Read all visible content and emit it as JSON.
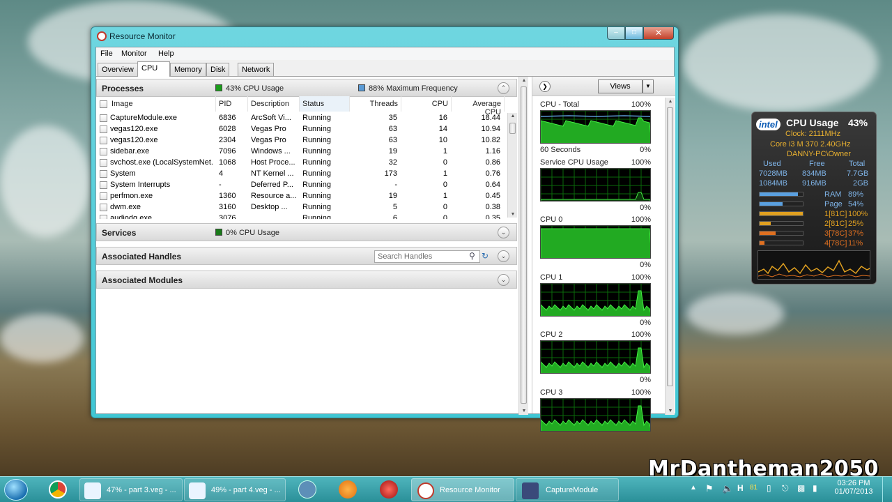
{
  "window": {
    "title": "Resource Monitor",
    "menu": [
      "File",
      "Monitor",
      "Help"
    ],
    "tabs": [
      "Overview",
      "CPU",
      "Memory",
      "Disk",
      "Network"
    ],
    "active_tab": "CPU"
  },
  "processes": {
    "title": "Processes",
    "cpu_usage": "43% CPU Usage",
    "max_freq": "88% Maximum Frequency",
    "columns": [
      "Image",
      "PID",
      "Description",
      "Status",
      "Threads",
      "CPU",
      "Average CPU"
    ],
    "rows": [
      {
        "image": "CaptureModule.exe",
        "pid": "6836",
        "desc": "ArcSoft Vi...",
        "status": "Running",
        "threads": "35",
        "cpu": "16",
        "avg": "18.44"
      },
      {
        "image": "vegas120.exe",
        "pid": "6028",
        "desc": "Vegas Pro",
        "status": "Running",
        "threads": "63",
        "cpu": "14",
        "avg": "10.94"
      },
      {
        "image": "vegas120.exe",
        "pid": "2304",
        "desc": "Vegas Pro",
        "status": "Running",
        "threads": "63",
        "cpu": "10",
        "avg": "10.82"
      },
      {
        "image": "sidebar.exe",
        "pid": "7096",
        "desc": "Windows ...",
        "status": "Running",
        "threads": "19",
        "cpu": "1",
        "avg": "1.16"
      },
      {
        "image": "svchost.exe (LocalSystemNet...",
        "pid": "1068",
        "desc": "Host Proce...",
        "status": "Running",
        "threads": "32",
        "cpu": "0",
        "avg": "0.86"
      },
      {
        "image": "System",
        "pid": "4",
        "desc": "NT Kernel ...",
        "status": "Running",
        "threads": "173",
        "cpu": "1",
        "avg": "0.76"
      },
      {
        "image": "System Interrupts",
        "pid": "-",
        "desc": "Deferred P...",
        "status": "Running",
        "threads": "-",
        "cpu": "0",
        "avg": "0.64"
      },
      {
        "image": "perfmon.exe",
        "pid": "1360",
        "desc": "Resource a...",
        "status": "Running",
        "threads": "19",
        "cpu": "1",
        "avg": "0.45"
      },
      {
        "image": "dwm.exe",
        "pid": "3160",
        "desc": "Desktop ...",
        "status": "Running",
        "threads": "5",
        "cpu": "0",
        "avg": "0.38"
      },
      {
        "image": "audiodg.exe",
        "pid": "3076",
        "desc": "",
        "status": "Running",
        "threads": "6",
        "cpu": "0",
        "avg": "0.35"
      }
    ]
  },
  "services": {
    "title": "Services",
    "cpu_usage": "0% CPU Usage"
  },
  "handles": {
    "title": "Associated Handles",
    "search_placeholder": "Search Handles"
  },
  "modules": {
    "title": "Associated Modules"
  },
  "graphs": {
    "views_label": "Views",
    "items": [
      {
        "label": "CPU - Total",
        "max": "100%",
        "footer_left": "60 Seconds",
        "footer_right": "0%"
      },
      {
        "label": "Service CPU Usage",
        "max": "100%",
        "footer_left": "",
        "footer_right": "0%"
      },
      {
        "label": "CPU 0",
        "max": "100%",
        "footer_left": "",
        "footer_right": "0%"
      },
      {
        "label": "CPU 1",
        "max": "100%",
        "footer_left": "",
        "footer_right": "0%"
      },
      {
        "label": "CPU 2",
        "max": "100%",
        "footer_left": "",
        "footer_right": "0%"
      },
      {
        "label": "CPU 3",
        "max": "100%",
        "footer_left": "",
        "footer_right": ""
      }
    ]
  },
  "gadget": {
    "brand": "intel",
    "title": "CPU Usage",
    "percent": "43%",
    "clock": "Clock: 2111MHz",
    "model": "Core i3 M 370 2.40GHz",
    "host": "DANNY-PC\\Owner",
    "mem_headers": [
      "Used",
      "Free",
      "Total"
    ],
    "mem_rows": [
      [
        "7028MB",
        "834MB",
        "7.7GB"
      ],
      [
        "1084MB",
        "916MB",
        "2GB"
      ]
    ],
    "meters": [
      {
        "label": "RAM",
        "value": "89%",
        "fraction": 0.89,
        "color": "#5aa0e0"
      },
      {
        "label": "Page",
        "value": "54%",
        "fraction": 0.54,
        "color": "#5aa0e0"
      },
      {
        "label": "1[81C]",
        "value": "100%",
        "fraction": 1.0,
        "color": "#e0a020"
      },
      {
        "label": "2[81C]",
        "value": "25%",
        "fraction": 0.25,
        "color": "#e0a020"
      },
      {
        "label": "3[78C]",
        "value": "37%",
        "fraction": 0.37,
        "color": "#e07020"
      },
      {
        "label": "4[78C]",
        "value": "11%",
        "fraction": 0.11,
        "color": "#e07020"
      }
    ]
  },
  "taskbar": {
    "buttons": [
      {
        "label": "47% - part 3.veg - ..."
      },
      {
        "label": "49% - part 4.veg - ..."
      },
      {
        "label": "Resource Monitor"
      },
      {
        "label": "CaptureModule"
      }
    ],
    "tray_number": "81",
    "time": "03:26 PM",
    "date": "01/07/2013"
  },
  "watermark": "MrDantheman2050"
}
